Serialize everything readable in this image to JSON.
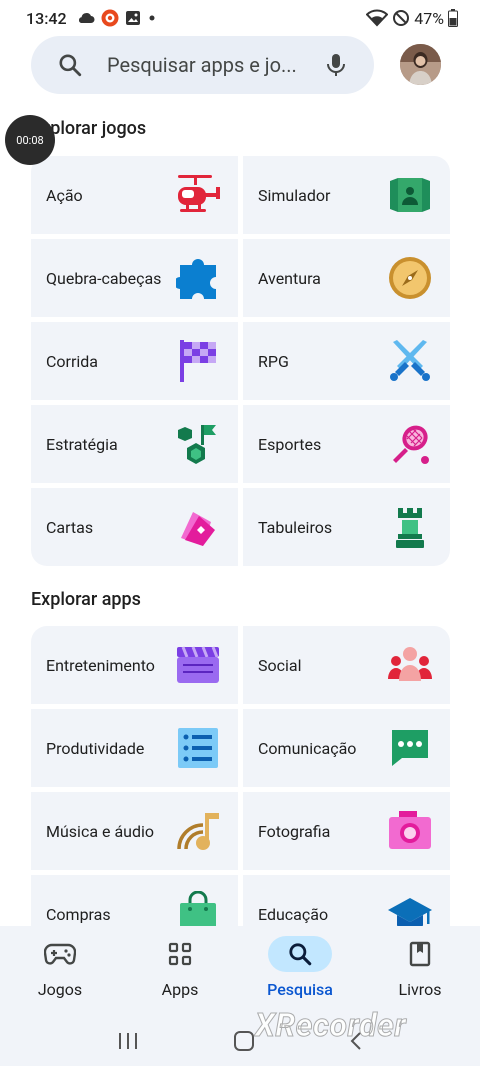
{
  "status_bar": {
    "time": "13:42",
    "battery": "47%"
  },
  "search": {
    "placeholder": "Pesquisar apps e jo..."
  },
  "recording": {
    "timer": "00:08"
  },
  "games_section": {
    "title": "Explorar jogos",
    "tiles": [
      {
        "label": "Ação",
        "icon": "helicopter-icon"
      },
      {
        "label": "Simulador",
        "icon": "simulator-icon"
      },
      {
        "label": "Quebra-cabeças",
        "icon": "puzzle-icon"
      },
      {
        "label": "Aventura",
        "icon": "compass-icon"
      },
      {
        "label": "Corrida",
        "icon": "race-flag-icon"
      },
      {
        "label": "RPG",
        "icon": "swords-icon"
      },
      {
        "label": "Estratégia",
        "icon": "strategy-icon"
      },
      {
        "label": "Esportes",
        "icon": "tennis-icon"
      },
      {
        "label": "Cartas",
        "icon": "cards-icon"
      },
      {
        "label": "Tabuleiros",
        "icon": "chess-rook-icon"
      }
    ]
  },
  "apps_section": {
    "title": "Explorar apps",
    "tiles": [
      {
        "label": "Entretenimento",
        "icon": "clapperboard-icon"
      },
      {
        "label": "Social",
        "icon": "people-icon"
      },
      {
        "label": "Produtividade",
        "icon": "checklist-icon"
      },
      {
        "label": "Comunicação",
        "icon": "chat-icon"
      },
      {
        "label": "Música e áudio",
        "icon": "music-note-icon"
      },
      {
        "label": "Fotografia",
        "icon": "camera-icon"
      },
      {
        "label": "Compras",
        "icon": "shopping-bag-icon"
      },
      {
        "label": "Educação",
        "icon": "graduation-cap-icon"
      }
    ]
  },
  "bottom_nav": {
    "items": [
      {
        "label": "Jogos",
        "icon": "gamepad-icon",
        "active": false
      },
      {
        "label": "Apps",
        "icon": "apps-grid-icon",
        "active": false
      },
      {
        "label": "Pesquisa",
        "icon": "search-icon",
        "active": true
      },
      {
        "label": "Livros",
        "icon": "book-icon",
        "active": false
      }
    ]
  },
  "watermark": "XRecorder",
  "colors": {
    "accent": "#0b57d0",
    "active_pill": "#c2e7ff",
    "tile_bg": "#f1f4f9",
    "search_bg": "#e9eef6"
  }
}
